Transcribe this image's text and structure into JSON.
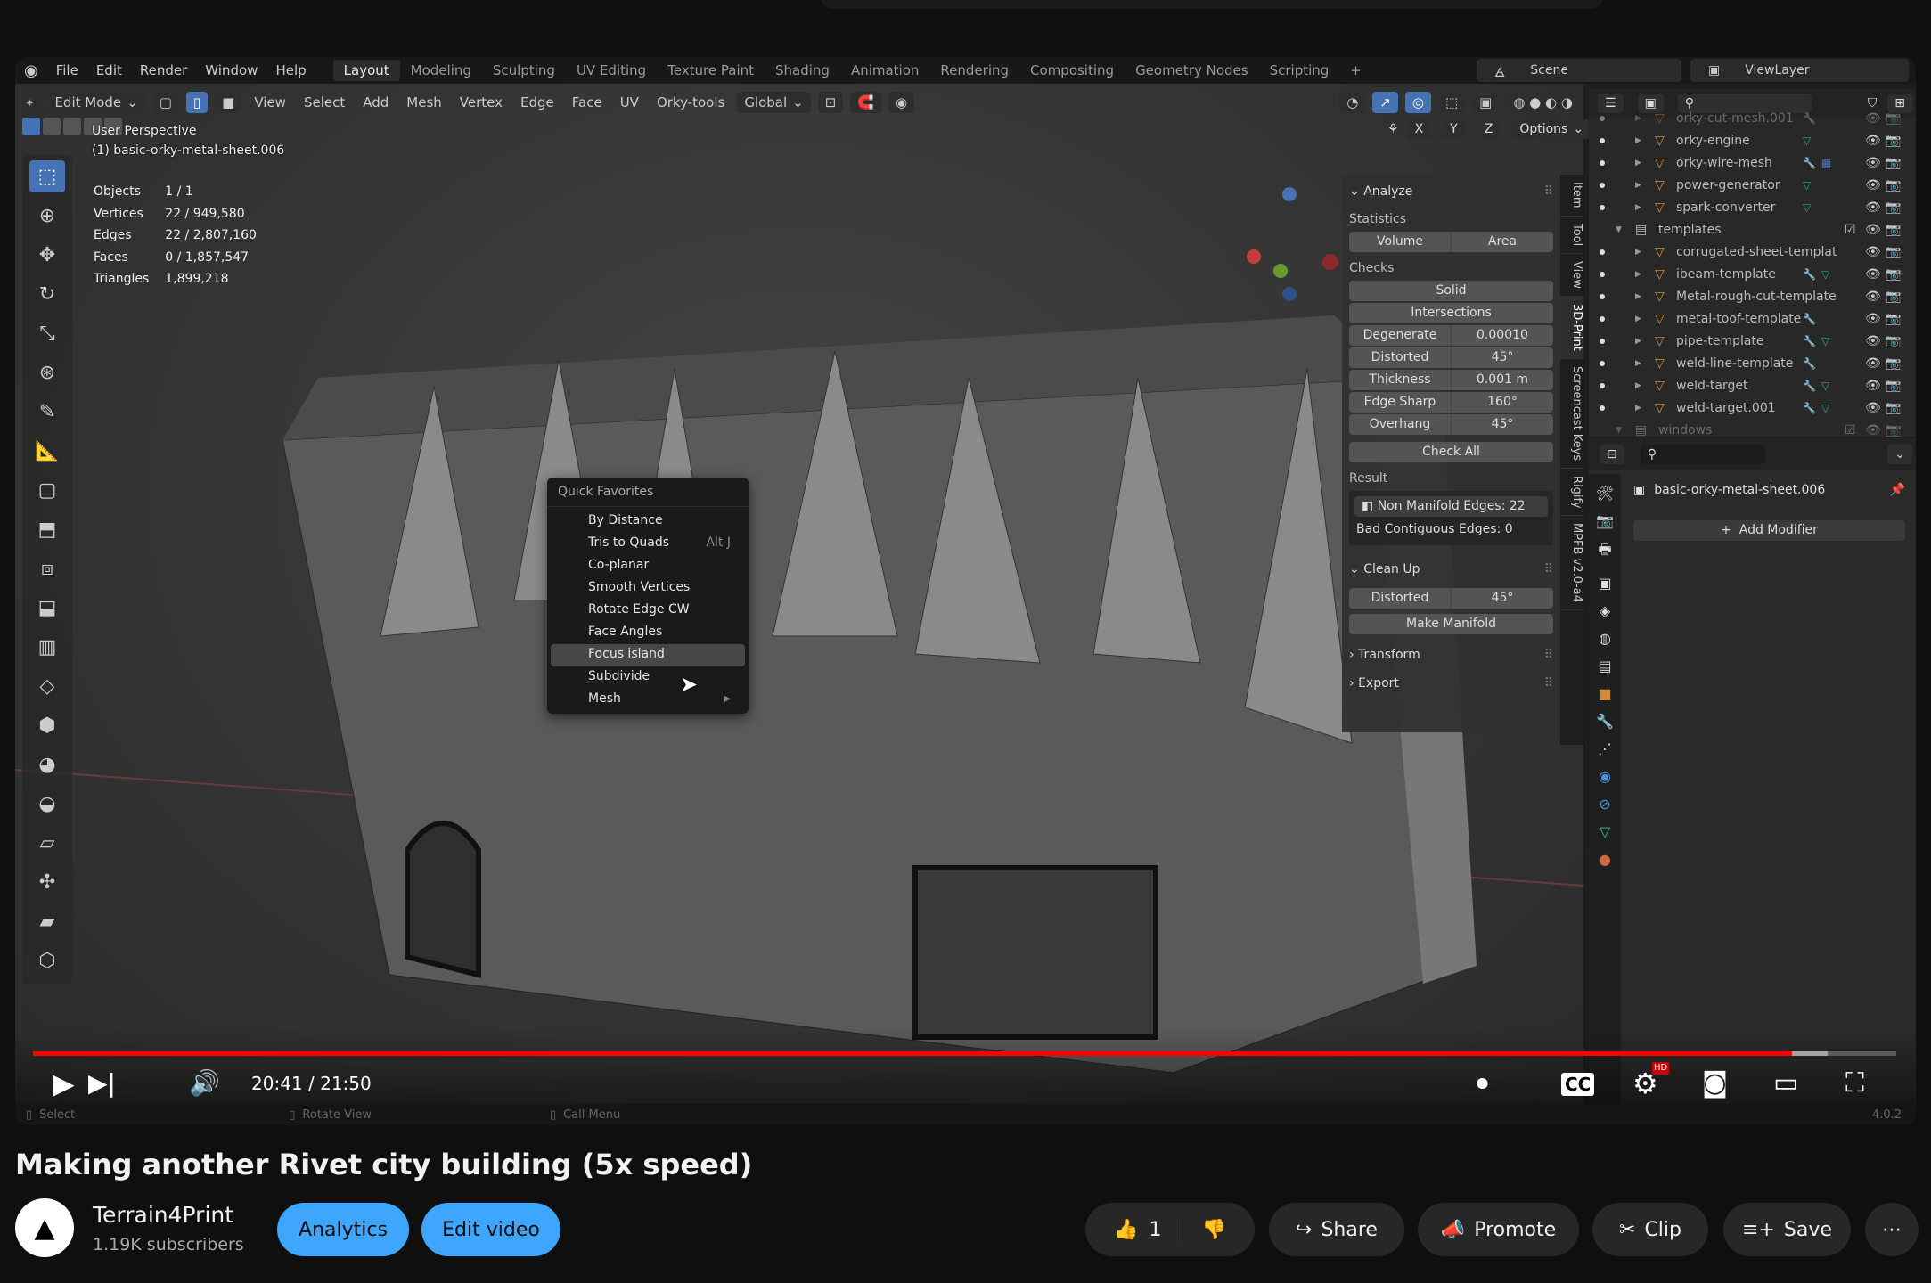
{
  "blender": {
    "menu": [
      "File",
      "Edit",
      "Render",
      "Window",
      "Help"
    ],
    "workspaces": [
      {
        "label": "Layout",
        "active": true
      },
      {
        "label": "Modeling"
      },
      {
        "label": "Sculpting"
      },
      {
        "label": "UV Editing"
      },
      {
        "label": "Texture Paint"
      },
      {
        "label": "Shading"
      },
      {
        "label": "Animation"
      },
      {
        "label": "Rendering"
      },
      {
        "label": "Compositing"
      },
      {
        "label": "Geometry Nodes"
      },
      {
        "label": "Scripting"
      }
    ],
    "add_workspace": "+",
    "scene": "Scene",
    "view_layer": "ViewLayer",
    "header": {
      "mode": "Edit Mode",
      "menus": [
        "View",
        "Select",
        "Add",
        "Mesh",
        "Vertex",
        "Edge",
        "Face",
        "UV",
        "Orky-tools"
      ],
      "orientation": "Global",
      "mirror_axes": [
        "X",
        "Y",
        "Z"
      ],
      "options": "Options"
    },
    "viewport": {
      "view_name": "User Perspective",
      "object_name": "(1) basic-orky-metal-sheet.006",
      "stats": [
        {
          "label": "Objects",
          "value": "1 / 1"
        },
        {
          "label": "Vertices",
          "value": "22 / 949,580"
        },
        {
          "label": "Edges",
          "value": "22 / 2,807,160"
        },
        {
          "label": "Faces",
          "value": "0 / 1,857,547"
        },
        {
          "label": "Triangles",
          "value": "1,899,218"
        }
      ],
      "gizmo_axes": [
        "X",
        "Y",
        "Z"
      ]
    },
    "quick_favorites": {
      "title": "Quick Favorites",
      "items": [
        {
          "label": "By Distance"
        },
        {
          "label": "Tris to Quads",
          "shortcut": "Alt J"
        },
        {
          "label": "Co-planar"
        },
        {
          "label": "Smooth Vertices"
        },
        {
          "label": "Rotate Edge CW"
        },
        {
          "label": "Face Angles"
        },
        {
          "label": "Focus island",
          "highlighted": true
        },
        {
          "label": "Subdivide"
        },
        {
          "label": "Mesh",
          "submenu": true
        }
      ]
    },
    "npanel": {
      "analyze": "Analyze",
      "statistics": "Statistics",
      "volume": "Volume",
      "area": "Area",
      "checks": "Checks",
      "solid": "Solid",
      "intersections": "Intersections",
      "check_rows": [
        {
          "label": "Degenerate",
          "value": "0.00010"
        },
        {
          "label": "Distorted",
          "value": "45°"
        },
        {
          "label": "Thickness",
          "value": "0.001 m"
        },
        {
          "label": "Edge Sharp",
          "value": "160°"
        },
        {
          "label": "Overhang",
          "value": "45°"
        }
      ],
      "check_all": "Check All",
      "result": "Result",
      "non_manifold": "Non Manifold Edges: 22",
      "bad_contiguous": "Bad Contiguous Edges: 0",
      "clean_up": "Clean Up",
      "distorted": "Distorted",
      "distorted_value": "45°",
      "make_manifold": "Make Manifold",
      "transform": "Transform",
      "export": "Export",
      "tabs": [
        "Item",
        "Tool",
        "View",
        "3D-Print",
        "Screencast Keys",
        "Rigify",
        "MPFB v2.0-a4"
      ],
      "active_tab": "3D-Print"
    },
    "outliner": {
      "items": [
        {
          "name": "orky-cut-mesh.001",
          "extras": "wrench",
          "partial": true
        },
        {
          "name": "orky-engine",
          "extras": "mesh"
        },
        {
          "name": "orky-wire-mesh",
          "extras": "wrench grid"
        },
        {
          "name": "power-generator",
          "extras": "mesh"
        },
        {
          "name": "spark-converter",
          "extras": "mesh"
        },
        {
          "name": "templates",
          "collection": true
        },
        {
          "name": "corrugated-sheet-templat"
        },
        {
          "name": "ibeam-template",
          "extras": "wrench mesh"
        },
        {
          "name": "Metal-rough-cut-template"
        },
        {
          "name": "metal-toof-template",
          "extras": "wrench"
        },
        {
          "name": "pipe-template",
          "extras": "wrench mesh"
        },
        {
          "name": "weld-line-template",
          "extras": "wrench"
        },
        {
          "name": "weld-target",
          "extras": "wrench mesh"
        },
        {
          "name": "weld-target.001",
          "extras": "wrench mesh"
        },
        {
          "name": "windows",
          "collection": true,
          "partial": true
        }
      ]
    },
    "properties": {
      "object_name": "basic-orky-metal-sheet.006",
      "add_modifier": "Add Modifier"
    },
    "status": {
      "select": "Select",
      "rotate": "Rotate View",
      "call_menu": "Call Menu",
      "version": "4.0.2"
    }
  },
  "player": {
    "time": "20:41 / 21:50",
    "progress_percent": 94.4,
    "buffered_percent": 96.3,
    "hd_badge": "HD",
    "colors": {
      "progress": "#ff0000",
      "accent": "#3ea6ff"
    }
  },
  "video": {
    "title": "Making another Rivet city building (5x speed)",
    "channel": "Terrain4Print",
    "subscribers": "1.19K subscribers",
    "analytics": "Analytics",
    "edit_video": "Edit video",
    "likes": "1",
    "share": "Share",
    "promote": "Promote",
    "clip": "Clip",
    "save": "Save"
  }
}
